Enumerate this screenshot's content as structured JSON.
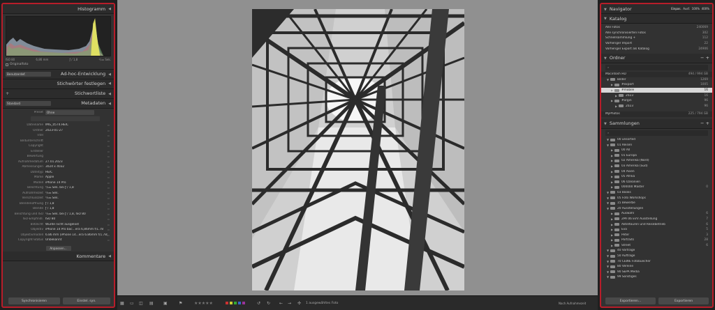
{
  "left": {
    "histogram": {
      "title": "Histogramm",
      "values": [
        "ISO 80",
        "6,86 mm",
        "ƒ / 1,8",
        "¹/₁₉₀ Sek."
      ],
      "original_label": "Originalfoto"
    },
    "quick_dev": {
      "preset": "Benutzerdef.",
      "title": "Ad-hoc-Entwicklung"
    },
    "keywords_title": "Stichwörter festlegen",
    "keyword_list_title": "Stichwortliste",
    "metadata": {
      "preset": "Standard",
      "title": "Metadaten",
      "preset_label": "Preset",
      "preset_value": "Ohne"
    },
    "rows": [
      {
        "k": "Dateiname",
        "v": "IMG_0574.HEIC"
      },
      {
        "k": "Ordner",
        "v": "2023-01-27"
      },
      {
        "k": "Titel",
        "v": ""
      },
      {
        "k": "Bildunterschrift",
        "v": ""
      },
      {
        "k": "Copyright",
        "v": ""
      },
      {
        "k": "Ersteller",
        "v": ""
      },
      {
        "k": "Bewertung",
        "v": ""
      },
      {
        "k": "Aufnahmedatum",
        "v": "27.01.2023"
      },
      {
        "k": "Abmessungen",
        "v": "3024 x 4032"
      },
      {
        "k": "Dateityp",
        "v": "HEIC"
      },
      {
        "k": "Marke",
        "v": "Apple"
      },
      {
        "k": "Modell",
        "v": "iPhone 14 Pro"
      },
      {
        "k": "Belichtung",
        "v": "¹/₁₉₀ Sek. bei ƒ / 1,8"
      },
      {
        "k": "Aufnahmezeit",
        "v": "¹/₁₉₀ Sek."
      },
      {
        "k": "Verschlusszeit",
        "v": "¹/₁₉₀ Sek."
      },
      {
        "k": "Blendenöffnung",
        "v": "ƒ / 1,8"
      },
      {
        "k": "Blende",
        "v": "ƒ / 1,8"
      },
      {
        "k": "Belichtung und ISO",
        "v": "¹/₁₉₀ Sek. bei ƒ / 1,8, ISO 80"
      },
      {
        "k": "ISO-Empfindl.",
        "v": "ISO 80"
      },
      {
        "k": "Blitzlicht",
        "v": "Wurde nicht ausgelöst"
      },
      {
        "k": "Objektiv",
        "v": "iPhone 14 Pro bac...era 6,86mm f/1.78"
      },
      {
        "k": "Objektivmodell",
        "v": "6.86 mm (iPhone 14...era 6.86mm f/1.78)"
      },
      {
        "k": "Copyright-Status",
        "v": "Unbekannt"
      }
    ],
    "customize_label": "Anpassen...",
    "comments_title": "Kommentare",
    "sync_button": "Synchronisieren",
    "import_button": "Einstel. syn."
  },
  "right": {
    "navigator": {
      "title": "Navigator",
      "opts": [
        "Einpas.",
        "Ausf.",
        "100%",
        "400%"
      ]
    },
    "catalog": {
      "title": "Katalog",
      "items": [
        {
          "n": "Alle Fotos",
          "c": "240069"
        },
        {
          "n": "Alle synchronisierten Fotos",
          "c": "302"
        },
        {
          "n": "Schnellsammlung +",
          "c": "112"
        },
        {
          "n": "Vorheriger Import",
          "c": "22"
        },
        {
          "n": "Vorheriger Export als Katalog",
          "c": "24906"
        }
      ]
    },
    "folders": {
      "title": "Ordner",
      "volume": "Macintosh HD",
      "volume_info": "494 / 994 GB",
      "items": [
        {
          "n": "Bilder",
          "c": "1269",
          "d": 1
        },
        {
          "n": "#export",
          "c": "1005",
          "d": 2
        },
        {
          "n": "#mobile",
          "c": "16",
          "d": 2,
          "hl": true
        },
        {
          "n": "2023",
          "c": "16",
          "d": 3
        },
        {
          "n": "#orgin",
          "c": "96",
          "d": 2
        },
        {
          "n": "2023",
          "c": "96",
          "d": 3
        }
      ],
      "my_photos": "MyPhotos",
      "my_photos_info": "225 / 794 GB"
    },
    "collections": {
      "title": "Sammlungen",
      "items": [
        {
          "n": "00 unsorted",
          "c": "",
          "d": 1
        },
        {
          "n": "01 Reisen",
          "c": "",
          "d": 1
        },
        {
          "n": "00 All",
          "c": "",
          "d": 2
        },
        {
          "n": "01 Europa",
          "c": "",
          "d": 2
        },
        {
          "n": "02 Amerika (Nord)",
          "c": "",
          "d": 2
        },
        {
          "n": "03 Amerika (Süd)",
          "c": "",
          "d": 2
        },
        {
          "n": "04 Asien",
          "c": "",
          "d": 2
        },
        {
          "n": "05 Afrika",
          "c": "",
          "d": 2
        },
        {
          "n": "06 Ozeanien",
          "c": "",
          "d": 2
        },
        {
          "n": "000000 Master",
          "c": "0",
          "d": 2
        },
        {
          "n": "03 Books",
          "c": "",
          "d": 1
        },
        {
          "n": "05 Foto Workshops",
          "c": "",
          "d": 1
        },
        {
          "n": "15 Bewerbe",
          "c": "",
          "d": 1
        },
        {
          "n": "20 Ausstellungen",
          "c": "",
          "d": 1
        },
        {
          "n": "Auswahl",
          "c": "6",
          "d": 2
        },
        {
          "n": "2PA 06 EVV Ausstellung",
          "c": "7",
          "d": 2
        },
        {
          "n": "Akteltouren und Reisebetrieb",
          "c": "6",
          "d": 2
        },
        {
          "n": "Eva",
          "c": "5",
          "d": 2
        },
        {
          "n": "Peter",
          "c": "3",
          "d": 2
        },
        {
          "n": "Portraits",
          "c": "28",
          "d": 2
        },
        {
          "n": "Street",
          "c": "6",
          "d": 2
        },
        {
          "n": "40 Vorträge",
          "c": "",
          "d": 1
        },
        {
          "n": "50 Aufträge",
          "c": "",
          "d": 1
        },
        {
          "n": "70 CEWE Fotobuecher",
          "c": "",
          "d": 1
        },
        {
          "n": "80 Vereine",
          "c": "",
          "d": 1
        },
        {
          "n": "90 SEPA Media",
          "c": "",
          "d": 1
        },
        {
          "n": "99 Sonstiges",
          "c": "",
          "d": 1
        }
      ]
    },
    "import_button": "Exportieren...",
    "export_button": "Exportieren"
  },
  "filmstrip": {
    "status": "1 ausgewähltes Foto",
    "sort_label": "Nach Aufnahmezeit"
  }
}
